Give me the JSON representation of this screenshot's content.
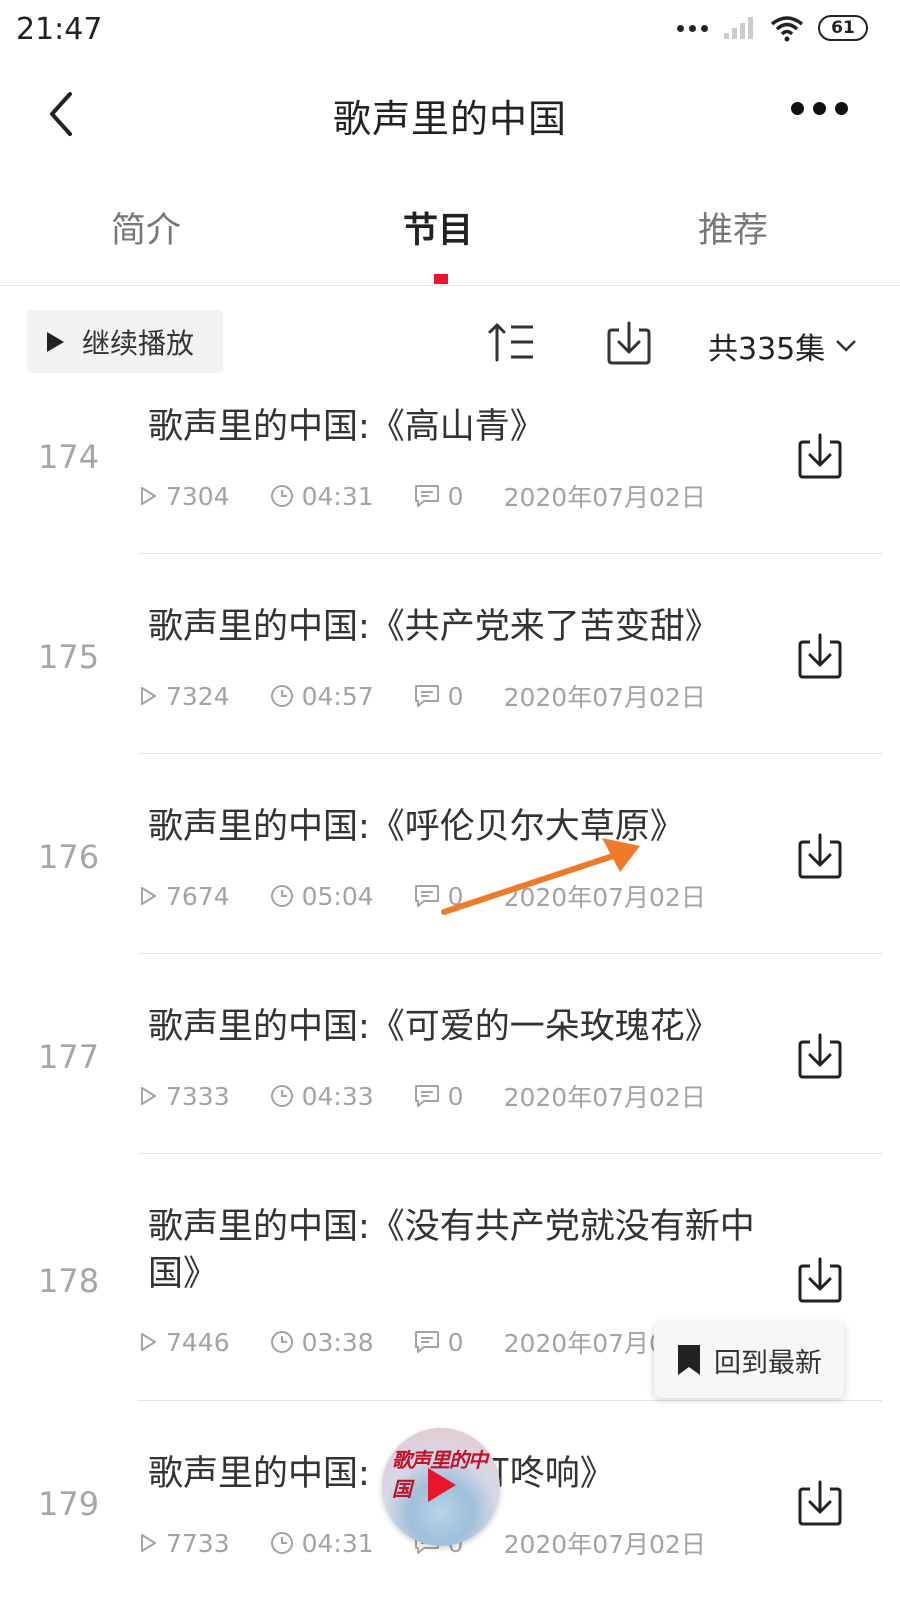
{
  "status_bar": {
    "time": "21:47",
    "battery": "61"
  },
  "header": {
    "title": "歌声里的中国"
  },
  "tabs": [
    {
      "label": "简介"
    },
    {
      "label": "节目"
    },
    {
      "label": "推荐"
    }
  ],
  "active_tab": "节目",
  "toolbar": {
    "continue_label": "继续播放",
    "episode_count": "共335集"
  },
  "episodes": [
    {
      "number": "174",
      "title": "歌声里的中国:《高山青》",
      "plays": "7304",
      "duration": "04:31",
      "comments": "0",
      "date": "2020年07月02日"
    },
    {
      "number": "175",
      "title": "歌声里的中国:《共产党来了苦变甜》",
      "plays": "7324",
      "duration": "04:57",
      "comments": "0",
      "date": "2020年07月02日"
    },
    {
      "number": "176",
      "title": "歌声里的中国:《呼伦贝尔大草原》",
      "plays": "7674",
      "duration": "05:04",
      "comments": "0",
      "date": "2020年07月02日"
    },
    {
      "number": "177",
      "title": "歌声里的中国:《可爱的一朵玫瑰花》",
      "plays": "7333",
      "duration": "04:33",
      "comments": "0",
      "date": "2020年07月02日"
    },
    {
      "number": "178",
      "title": "歌声里的中国:《没有共产党就没有新中国》",
      "plays": "7446",
      "duration": "03:38",
      "comments": "0",
      "date": "2020年07月02日"
    },
    {
      "number": "179",
      "title": "歌声里的中国:《泉水叮咚响》",
      "plays": "7733",
      "duration": "04:31",
      "comments": "0",
      "date": "2020年07月02日"
    }
  ],
  "back_to_latest_label": "回到最新",
  "mini_player": {
    "cover_text": "歌声里的中国"
  },
  "colors": {
    "accent": "#e8152d",
    "annotation_arrow": "#f07a2a",
    "meta_text": "#a3a3a3"
  }
}
